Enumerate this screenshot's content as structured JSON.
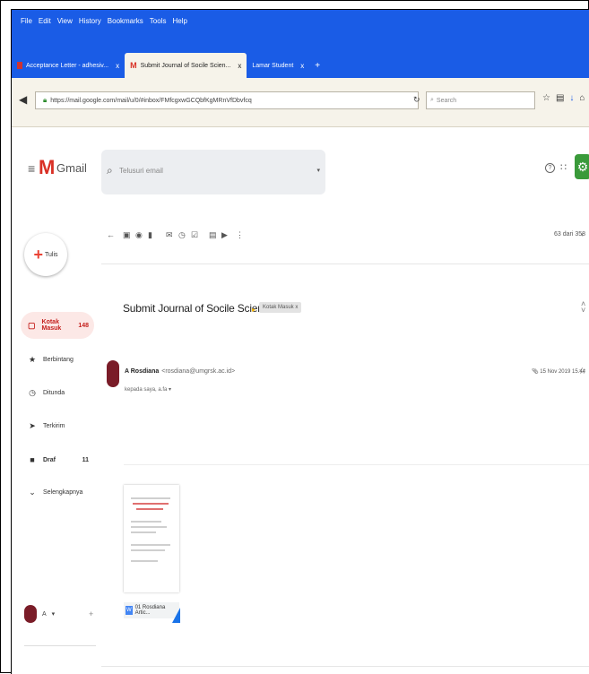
{
  "browser": {
    "menu": [
      "File",
      "Edit",
      "View",
      "History",
      "Bookmarks",
      "Tools",
      "Help"
    ],
    "tabs": [
      {
        "label": "Acceptance Letter - adhesiv...",
        "close": "x",
        "active": false
      },
      {
        "label": "Submit Journal of Socile Scien...",
        "close": "x",
        "active": true
      },
      {
        "label": "Lamar Student",
        "close": "x",
        "active": false
      }
    ],
    "new_tab": "+",
    "url": "https://mail.google.com/mail/u/0/#inbox/FMfcgxwGCQbfKgMRnVfDbvfcq",
    "search_placeholder": "Search"
  },
  "gmail": {
    "logo_text": "Gmail",
    "search_placeholder": "Telusuri email",
    "compose_label": "Tulis",
    "sidebar": [
      {
        "label": "Kotak Masuk",
        "count": "148",
        "active": true,
        "icon": "inbox-icon"
      },
      {
        "label": "Berbintang",
        "count": "",
        "active": false,
        "icon": "star-icon"
      },
      {
        "label": "Ditunda",
        "count": "",
        "active": false,
        "icon": "clock-icon"
      },
      {
        "label": "Terkirim",
        "count": "",
        "active": false,
        "icon": "send-icon"
      },
      {
        "label": "Draf",
        "count": "11",
        "active": false,
        "icon": "draft-icon"
      },
      {
        "label": "Selengkapnya",
        "count": "",
        "active": false,
        "icon": "chevron-down-icon"
      }
    ],
    "account_name": "A",
    "pager": "63 dari 358",
    "subject": "Submit Journal of Socile Science",
    "label": "Kotak Masuk x",
    "sender_name": "A Rosdiana",
    "sender_email": "<rosdiana@umgrsk.ac.id>",
    "recipients": "kepada saya, a.fa ▾",
    "date": "15 Nov 2019 15.44",
    "attachment_name": "01 Rosdiana Artic..."
  }
}
